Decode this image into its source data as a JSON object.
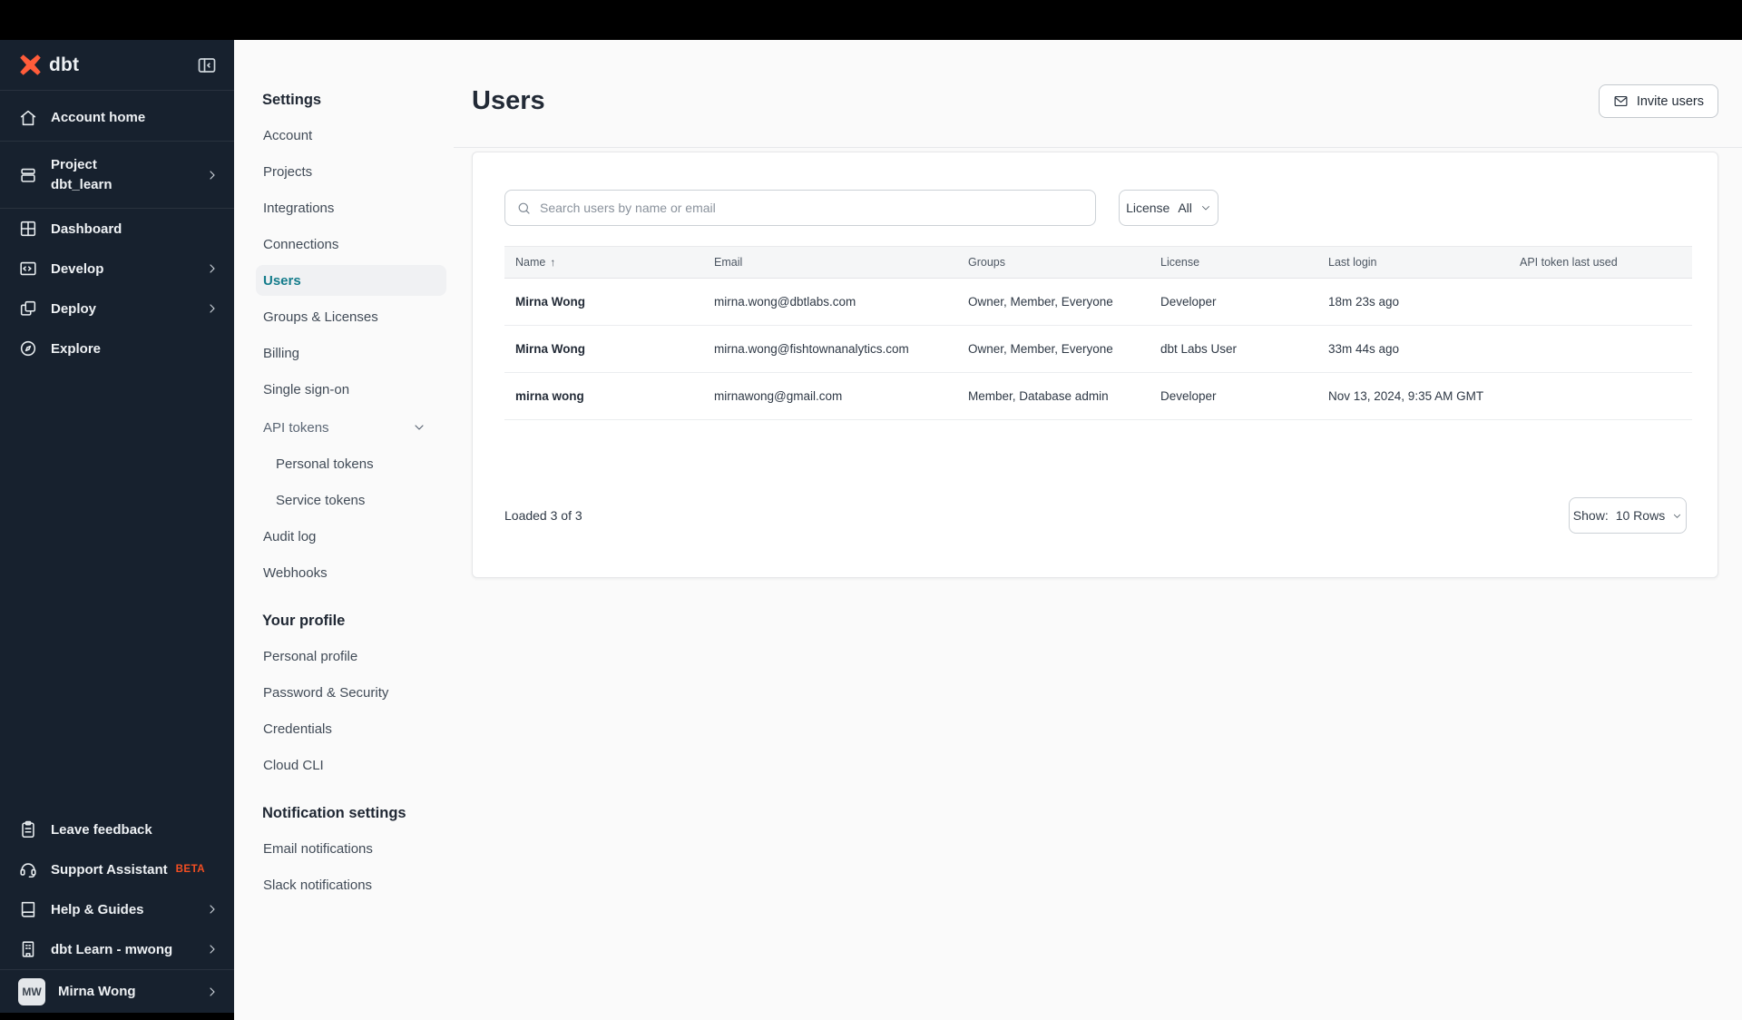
{
  "sidebar": {
    "logo_text": "dbt",
    "items": [
      {
        "label": "Account home"
      },
      {
        "label": "Project",
        "sublabel": "dbt_learn"
      },
      {
        "label": "Dashboard"
      },
      {
        "label": "Develop"
      },
      {
        "label": "Deploy"
      },
      {
        "label": "Explore"
      }
    ],
    "footer_items": [
      {
        "label": "Leave feedback"
      },
      {
        "label": "Support Assistant",
        "badge": "BETA"
      },
      {
        "label": "Help & Guides"
      },
      {
        "label": "dbt Learn - mwong"
      }
    ],
    "user": {
      "initials": "MW",
      "name": "Mirna Wong"
    }
  },
  "settings_nav": {
    "title": "Settings",
    "items": [
      {
        "label": "Account"
      },
      {
        "label": "Projects"
      },
      {
        "label": "Integrations"
      },
      {
        "label": "Connections"
      },
      {
        "label": "Users"
      },
      {
        "label": "Groups & Licenses"
      },
      {
        "label": "Billing"
      },
      {
        "label": "Single sign-on"
      },
      {
        "label": "API tokens"
      },
      {
        "label": "Personal tokens"
      },
      {
        "label": "Service tokens"
      },
      {
        "label": "Audit log"
      },
      {
        "label": "Webhooks"
      }
    ],
    "profile": {
      "title": "Your profile",
      "items": [
        {
          "label": "Personal profile"
        },
        {
          "label": "Password & Security"
        },
        {
          "label": "Credentials"
        },
        {
          "label": "Cloud CLI"
        }
      ]
    },
    "notifications": {
      "title": "Notification settings",
      "items": [
        {
          "label": "Email notifications"
        },
        {
          "label": "Slack notifications"
        }
      ]
    }
  },
  "main": {
    "title": "Users",
    "invite_button": "Invite users",
    "search_placeholder": "Search users by name or email",
    "license_label": "License",
    "license_value": "All",
    "table": {
      "headers": [
        "Name",
        "Email",
        "Groups",
        "License",
        "Last login",
        "API token last used"
      ],
      "sort_arrow": "↑",
      "rows": [
        {
          "name": "Mirna Wong",
          "email": "mirna.wong@dbtlabs.com",
          "groups": "Owner, Member, Everyone",
          "license": "Developer",
          "last_login": "18m 23s ago",
          "api_token": ""
        },
        {
          "name": "Mirna Wong",
          "email": "mirna.wong@fishtownanalytics.com",
          "groups": "Owner, Member, Everyone",
          "license": "dbt Labs User",
          "last_login": "33m 44s ago",
          "api_token": ""
        },
        {
          "name": "mirna wong",
          "email": "mirnawong@gmail.com",
          "groups": "Member, Database admin",
          "license": "Developer",
          "last_login": "Nov 13, 2024, 9:35 AM GMT",
          "api_token": ""
        }
      ]
    },
    "loaded_text": "Loaded 3 of 3",
    "show_label": "Show:",
    "show_value": "10 Rows"
  },
  "colors": {
    "accent_orange": "#ff5c3a",
    "beta_badge": "#f34e22",
    "active_teal": "#147c8b",
    "sidebar_bg": "#17212e"
  }
}
